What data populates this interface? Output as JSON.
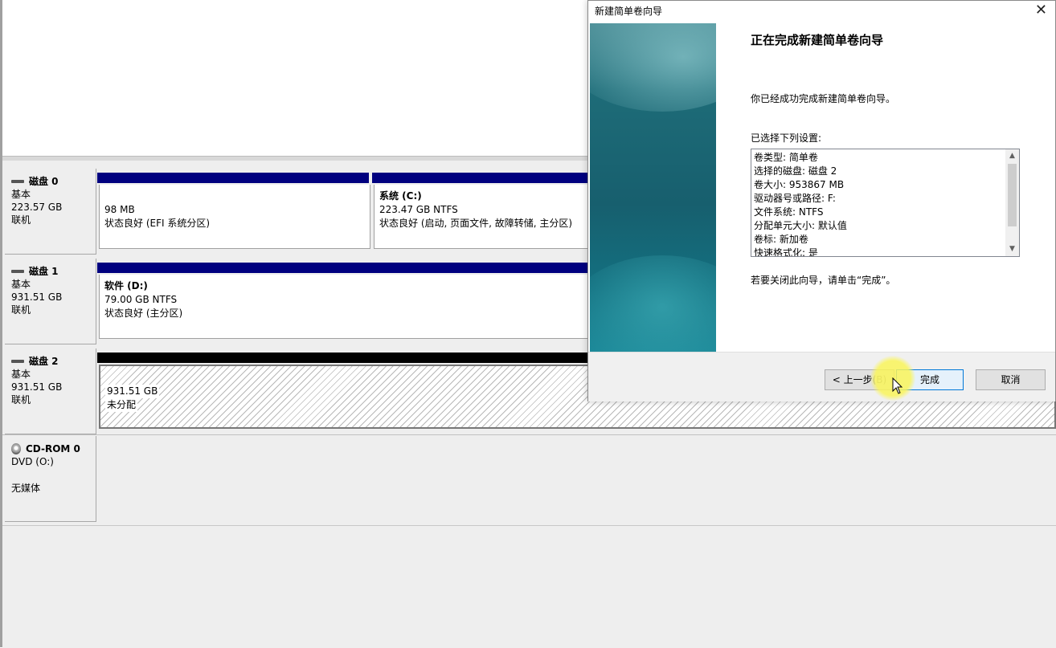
{
  "disks": [
    {
      "name": "磁盘 0",
      "type": "基本",
      "size": "223.57 GB",
      "status": "联机",
      "partitions": [
        {
          "name": "",
          "size": "98 MB",
          "status": "状态良好 (EFI 系统分区)"
        },
        {
          "name": "系统  (C:)",
          "size": "223.47 GB NTFS",
          "status": "状态良好 (启动, 页面文件, 故障转储, 主分区)"
        }
      ]
    },
    {
      "name": "磁盘 1",
      "type": "基本",
      "size": "931.51 GB",
      "status": "联机",
      "partitions": [
        {
          "name": "软件  (D:)",
          "size": "79.00 GB NTFS",
          "status": "状态良好 (主分区)"
        }
      ]
    },
    {
      "name": "磁盘 2",
      "type": "基本",
      "size": "931.51 GB",
      "status": "联机",
      "partitions": [
        {
          "name": "",
          "size": "931.51 GB",
          "status": "未分配"
        }
      ]
    }
  ],
  "cdrom": {
    "name": "CD-ROM 0",
    "type": "DVD (O:)",
    "status": "无媒体"
  },
  "wizard": {
    "title": "新建简单卷向导",
    "close": "✕",
    "heading": "正在完成新建简单卷向导",
    "message": "你已经成功完成新建简单卷向导。",
    "settings_label": "已选择下列设置:",
    "settings": [
      "卷类型: 简单卷",
      "选择的磁盘: 磁盘 2",
      "卷大小: 953867 MB",
      "驱动器号或路径: F:",
      "文件系统: NTFS",
      "分配单元大小: 默认值",
      "卷标: 新加卷",
      "快速格式化: 是"
    ],
    "close_hint": "若要关闭此向导，请单击“完成”。",
    "buttons": {
      "back": "< 上一步",
      "back_key": "(B)",
      "finish": "完成",
      "cancel": "取消"
    }
  },
  "colors": {
    "primary_partition": "#00007f",
    "unallocated": "#000000",
    "accent": "#0078d7"
  }
}
